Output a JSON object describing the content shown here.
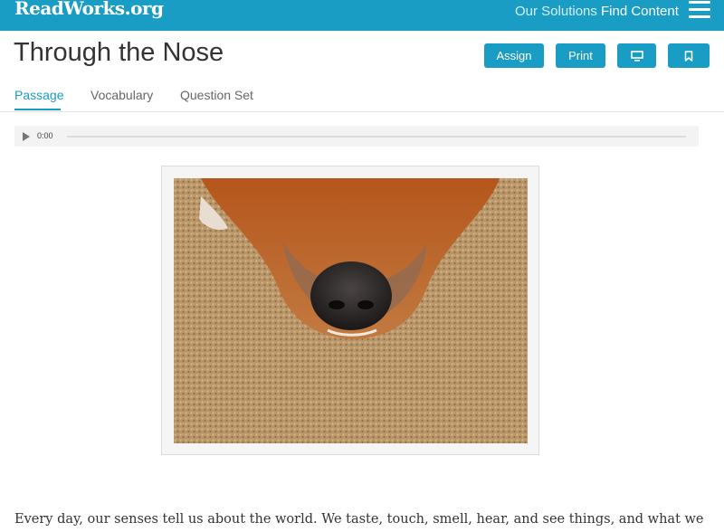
{
  "header": {
    "logo": "ReadWorks.org",
    "nav": {
      "solutions": "Our Solutions",
      "find_content": "Find Content"
    },
    "menu_icon": "hamburger-menu-icon"
  },
  "article": {
    "title": "Through the Nose",
    "actions": {
      "assign": "Assign",
      "print": "Print",
      "present_icon": "monitor-icon",
      "bookmark_icon": "bookmark-icon"
    }
  },
  "tabs": [
    {
      "label": "Passage",
      "active": true
    },
    {
      "label": "Vocabulary",
      "active": false
    },
    {
      "label": "Question Set",
      "active": false
    }
  ],
  "audio": {
    "time": "0:00",
    "play_icon": "play-icon"
  },
  "passage": {
    "image_alt": "dog-nose-on-carpet",
    "first_line": "Every day, our senses tell us about the world. We taste, touch, smell, hear, and see things, and what we"
  },
  "colors": {
    "brand": "#1a9dc4",
    "title_text": "#333333",
    "tab_inactive": "#666666"
  }
}
